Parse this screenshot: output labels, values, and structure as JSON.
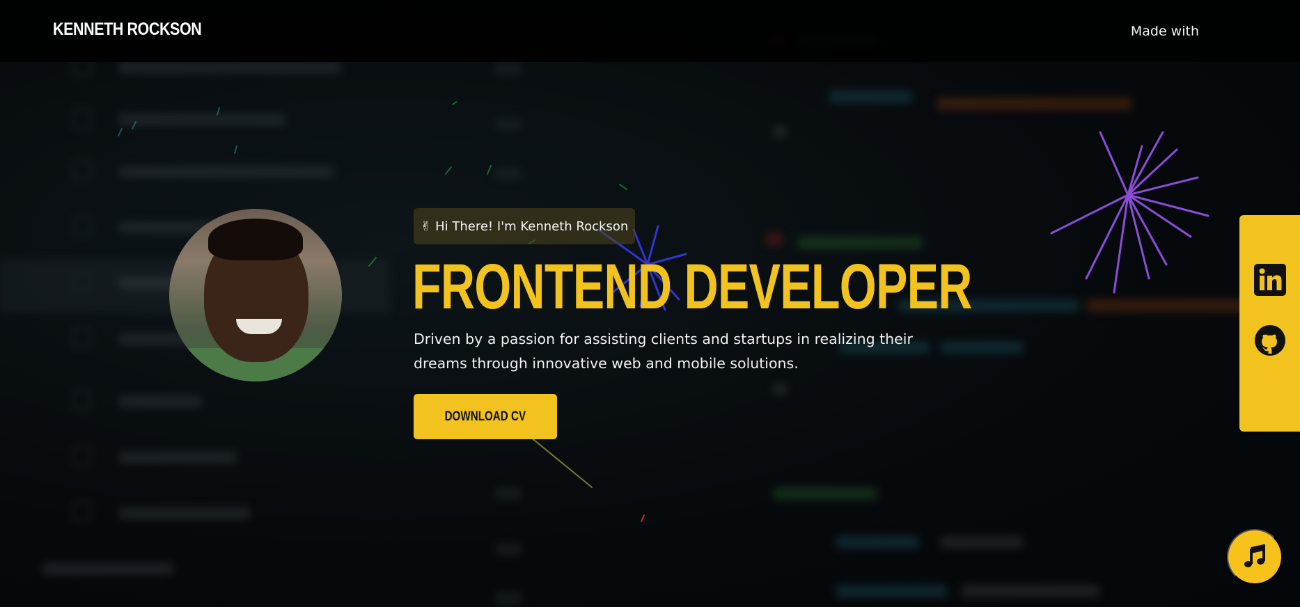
{
  "header": {
    "brand": "KENNETH ROCKSON",
    "made_with": "Made with"
  },
  "hero": {
    "greeting": "Hi There! I'm Kenneth Rockson",
    "greeting_icon": "victory-hand-icon",
    "title": "FRONTEND DEVELOPER",
    "description": "Driven by a passion for assisting clients and startups in realizing their dreams through innovative web and mobile solutions.",
    "cta_label": "DOWNLOAD CV"
  },
  "social": {
    "items": [
      {
        "name": "linkedin",
        "icon": "linkedin-icon"
      },
      {
        "name": "github",
        "icon": "github-icon"
      }
    ]
  },
  "music": {
    "icon": "music-note-icon"
  },
  "colors": {
    "accent": "#f2c21f",
    "background": "#05090d",
    "header": "#000000",
    "text": "#f1f1f1"
  }
}
